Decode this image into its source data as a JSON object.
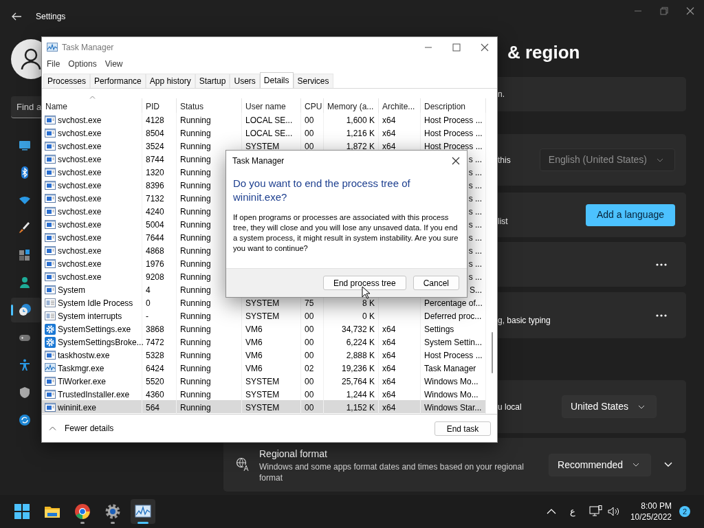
{
  "settings": {
    "title": "Settings",
    "search": {
      "placeholder": "Find a"
    },
    "sidebar": [
      {
        "kind": "system",
        "selected": false
      },
      {
        "kind": "bluetooth",
        "selected": false
      },
      {
        "kind": "network",
        "selected": false
      },
      {
        "kind": "personalization",
        "selected": false
      },
      {
        "kind": "apps",
        "selected": false
      },
      {
        "kind": "accounts",
        "selected": false
      },
      {
        "kind": "time",
        "selected": true
      },
      {
        "kind": "gaming",
        "selected": false
      },
      {
        "kind": "accessibility",
        "selected": false
      },
      {
        "kind": "privacy",
        "selected": false
      },
      {
        "kind": "update",
        "selected": false
      }
    ],
    "page_title": "& region",
    "cards": [
      {
        "kind": "text",
        "text": "n."
      },
      {
        "kind": "dropdown",
        "text": "this",
        "value": "English (United States)",
        "disabled": true
      },
      {
        "kind": "button",
        "text": "list",
        "button": "Add a language"
      },
      {
        "kind": "more"
      },
      {
        "kind": "more",
        "text": "g, basic typing"
      },
      {
        "kind": "dropdown",
        "text": "u local",
        "value": "United States",
        "disabled": false
      },
      {
        "kind": "regional",
        "title": "Regional format",
        "text": "Windows and some apps format dates and times based on your regional format",
        "value": "Recommended",
        "expanded": false
      }
    ]
  },
  "task_manager": {
    "title": "Task Manager",
    "menu": [
      "File",
      "Options",
      "View"
    ],
    "tabs": [
      {
        "label": "Processes",
        "selected": false
      },
      {
        "label": "Performance",
        "selected": false
      },
      {
        "label": "App history",
        "selected": false
      },
      {
        "label": "Startup",
        "selected": false
      },
      {
        "label": "Users",
        "selected": false
      },
      {
        "label": "Details",
        "selected": true
      },
      {
        "label": "Services",
        "selected": false
      }
    ],
    "columns": [
      {
        "label": "Name",
        "sorted": true
      },
      {
        "label": "PID",
        "sorted": false
      },
      {
        "label": "Status",
        "sorted": false
      },
      {
        "label": "User name",
        "sorted": false
      },
      {
        "label": "CPU",
        "sorted": false
      },
      {
        "label": "Memory (a...",
        "sorted": false
      },
      {
        "label": "Archite...",
        "sorted": false
      },
      {
        "label": "Description",
        "sorted": false
      }
    ],
    "rows": [
      {
        "kind": "service",
        "name": "svchost.exe",
        "pid": "4128",
        "status": "Running",
        "user": "LOCAL SE...",
        "cpu": "00",
        "memory": "1,600 K",
        "arch": "x64",
        "description": "Host Process ...",
        "selected": false
      },
      {
        "kind": "service",
        "name": "svchost.exe",
        "pid": "8504",
        "status": "Running",
        "user": "LOCAL SE...",
        "cpu": "00",
        "memory": "1,216 K",
        "arch": "x64",
        "description": "Host Process ...",
        "selected": false
      },
      {
        "kind": "service",
        "name": "svchost.exe",
        "pid": "3524",
        "status": "Running",
        "user": "SYSTEM",
        "cpu": "00",
        "memory": "1,872 K",
        "arch": "x64",
        "description": "Host Process ...",
        "selected": false
      },
      {
        "kind": "service",
        "name": "svchost.exe",
        "pid": "8744",
        "status": "Running",
        "description_tail": "s ...",
        "selected": false
      },
      {
        "kind": "service",
        "name": "svchost.exe",
        "pid": "1320",
        "status": "Running",
        "description_tail": "s ...",
        "selected": false
      },
      {
        "kind": "service",
        "name": "svchost.exe",
        "pid": "8396",
        "status": "Running",
        "description_tail": "s ...",
        "selected": false
      },
      {
        "kind": "service",
        "name": "svchost.exe",
        "pid": "7132",
        "status": "Running",
        "description_tail": "s ...",
        "selected": false
      },
      {
        "kind": "service",
        "name": "svchost.exe",
        "pid": "4240",
        "status": "Running",
        "description_tail": "s ...",
        "selected": false
      },
      {
        "kind": "service",
        "name": "svchost.exe",
        "pid": "5004",
        "status": "Running",
        "description_tail": "s ...",
        "selected": false
      },
      {
        "kind": "service",
        "name": "svchost.exe",
        "pid": "7644",
        "status": "Running",
        "description_tail": "s ...",
        "selected": false
      },
      {
        "kind": "service",
        "name": "svchost.exe",
        "pid": "4868",
        "status": "Running",
        "description_tail": "s ...",
        "selected": false
      },
      {
        "kind": "service",
        "name": "svchost.exe",
        "pid": "1976",
        "status": "Running",
        "description_tail": "s ...",
        "selected": false
      },
      {
        "kind": "service",
        "name": "svchost.exe",
        "pid": "9208",
        "status": "Running",
        "description_tail": "s ...",
        "selected": false
      },
      {
        "kind": "service",
        "name": "System",
        "pid": "4",
        "status": "Running",
        "description_tail": "S...",
        "selected": false
      },
      {
        "kind": "system",
        "name": "System Idle Process",
        "pid": "0",
        "status": "Running",
        "user": "SYSTEM",
        "cpu": "75",
        "memory": "8 K",
        "description": "Percentage of...",
        "selected": false
      },
      {
        "kind": "system",
        "name": "System interrupts",
        "pid": "-",
        "status": "Running",
        "user": "SYSTEM",
        "cpu": "00",
        "memory": "0 K",
        "description": "Deferred proc...",
        "selected": false
      },
      {
        "kind": "settings",
        "name": "SystemSettings.exe",
        "pid": "3868",
        "status": "Running",
        "user": "VM6",
        "cpu": "00",
        "memory": "34,732 K",
        "arch": "x64",
        "description": "Settings",
        "selected": false
      },
      {
        "kind": "settings",
        "name": "SystemSettingsBroke...",
        "pid": "7472",
        "status": "Running",
        "user": "VM6",
        "cpu": "00",
        "memory": "6,224 K",
        "arch": "x64",
        "description": "System Settin...",
        "selected": false
      },
      {
        "kind": "service",
        "name": "taskhostw.exe",
        "pid": "5328",
        "status": "Running",
        "user": "VM6",
        "cpu": "00",
        "memory": "2,888 K",
        "arch": "x64",
        "description": "Host Process ...",
        "selected": false
      },
      {
        "kind": "taskmgr",
        "name": "Taskmgr.exe",
        "pid": "6424",
        "status": "Running",
        "user": "VM6",
        "cpu": "02",
        "memory": "19,236 K",
        "arch": "x64",
        "description": "Task Manager",
        "selected": false
      },
      {
        "kind": "service",
        "name": "TiWorker.exe",
        "pid": "5520",
        "status": "Running",
        "user": "SYSTEM",
        "cpu": "00",
        "memory": "25,764 K",
        "arch": "x64",
        "description": "Windows Mo...",
        "selected": false
      },
      {
        "kind": "service",
        "name": "TrustedInstaller.exe",
        "pid": "4360",
        "status": "Running",
        "user": "SYSTEM",
        "cpu": "00",
        "memory": "1,244 K",
        "arch": "x64",
        "description": "Windows Mo...",
        "selected": false
      },
      {
        "kind": "service",
        "name": "wininit.exe",
        "pid": "564",
        "status": "Running",
        "user": "SYSTEM",
        "cpu": "00",
        "memory": "1,152 K",
        "arch": "x64",
        "description": "Windows Star...",
        "selected": true
      }
    ],
    "footer": {
      "toggle": "Fewer details",
      "button": "End task"
    }
  },
  "dialog": {
    "title": "Task Manager",
    "heading": "Do you want to end the process tree of wininit.exe?",
    "body": "If open programs or processes are associated with this process tree, they will close and you will lose any unsaved data. If you end a system process, it might result in system instability. Are you sure you want to continue?",
    "buttons": [
      "End process tree",
      "Cancel"
    ]
  },
  "taskbar": {
    "apps": [
      {
        "kind": "start",
        "running": false,
        "active": false
      },
      {
        "kind": "explorer",
        "running": false,
        "active": false
      },
      {
        "kind": "browser",
        "running": true,
        "active": false
      },
      {
        "kind": "settings",
        "running": true,
        "active": false
      },
      {
        "kind": "taskmgr",
        "running": true,
        "active": true
      }
    ],
    "input_indicator": "ع",
    "time": "8:00 PM",
    "date": "10/25/2022",
    "notifications": "2"
  }
}
